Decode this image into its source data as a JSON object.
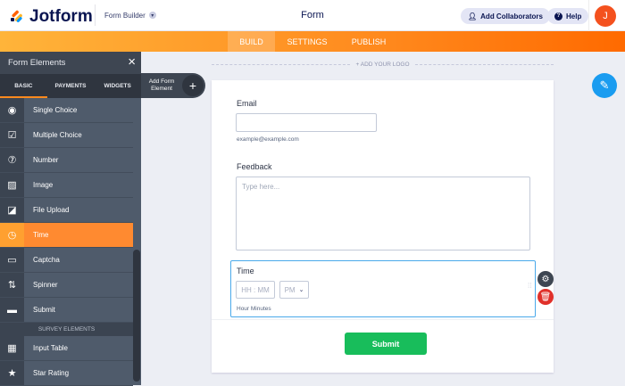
{
  "header": {
    "brand": "Jotform",
    "builder": "Form Builder",
    "title": "Form",
    "collab": "Add Collaborators",
    "help": "Help",
    "avatar": "J"
  },
  "nav": {
    "tabs": [
      "BUILD",
      "SETTINGS",
      "PUBLISH"
    ],
    "active": "BUILD"
  },
  "sidebar": {
    "title": "Form Elements",
    "tabs": [
      "BASIC",
      "PAYMENTS",
      "WIDGETS"
    ],
    "items": [
      {
        "label": "Single Choice",
        "icon": "◉"
      },
      {
        "label": "Multiple Choice",
        "icon": "☑"
      },
      {
        "label": "Number",
        "icon": "⑦"
      },
      {
        "label": "Image",
        "icon": "▨"
      },
      {
        "label": "File Upload",
        "icon": "◪"
      },
      {
        "label": "Time",
        "icon": "◷"
      },
      {
        "label": "Captcha",
        "icon": "▭"
      },
      {
        "label": "Spinner",
        "icon": "⇅"
      },
      {
        "label": "Submit",
        "icon": "▬"
      }
    ],
    "survey_header": "SURVEY ELEMENTS",
    "survey_items": [
      {
        "label": "Input Table",
        "icon": "▦"
      },
      {
        "label": "Star Rating",
        "icon": "★"
      }
    ],
    "add_element": "Add Form Element"
  },
  "canvas": {
    "add_logo": "+ ADD YOUR LOGO",
    "email": {
      "label": "Email",
      "sublabel": "example@example.com"
    },
    "feedback": {
      "label": "Feedback",
      "placeholder": "Type here..."
    },
    "time": {
      "label": "Time",
      "placeholder": "HH : MM",
      "ampm": "PM",
      "sublabel": "Hour Minutes"
    },
    "submit": "Submit"
  },
  "colors": {
    "accent": "#ff8a1e",
    "submit": "#18bd5b",
    "selected": "#4aa9ea"
  }
}
